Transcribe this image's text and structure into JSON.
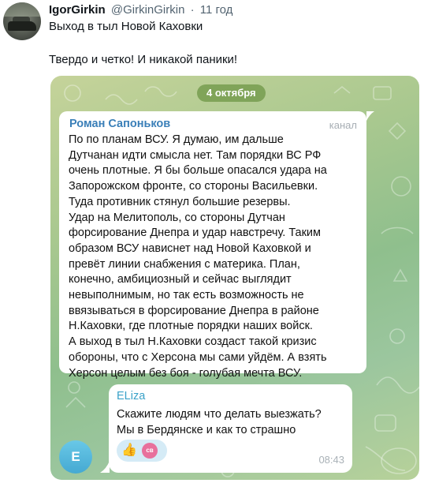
{
  "tweet": {
    "display_name": "IgorGirkin",
    "handle": "@GirkinGirkin",
    "separator": "·",
    "time_ago": "11 год",
    "line1": "Выход в тыл Новой Каховки",
    "line2": "Твердо и четко! И никакой паники!"
  },
  "screenshot": {
    "date_pill": "4 октября",
    "message1": {
      "sender": "Роман Сапоньков",
      "tag": "канал",
      "lines": [
        "По по планам ВСУ. Я думаю, им дальше",
        "Дутчанан идти смысла нет. Там порядки ВС РФ",
        "очень плотные. Я бы больше опасался удара на",
        "Запорожском фронте, со стороны Васильевки.",
        "Туда противник стянул большие резервы.",
        "Удар на Мелитополь, со стороны Дутчан",
        "форсирование Днепра и удар навстречу. Таким",
        "образом ВСУ нависнет над Новой Каховкой и",
        "превёт линии снабжения с материка. План,",
        "конечно, амбициозный и сейчас выглядит",
        "невыполнимым, но так есть возможность не",
        "ввязываться в форсирование Днепра в районе",
        "Н.Каховки, где плотные порядки наших войск.",
        "А выход в тыл Н.Каховки создаст такой кризис",
        "обороны, что с Херсона мы сами уйдём. А взять",
        "Херсон целым без боя - голубая мечта ВСУ."
      ]
    },
    "message2": {
      "sender": "ELiza",
      "lines": [
        "Скажите людям что делать выезжать?",
        "Мы в Бердянске и как то страшно"
      ],
      "reaction_emoji": "👍",
      "reaction_avatar_text": "св",
      "time": "08:43"
    },
    "avatar_letter": "E"
  },
  "colors": {
    "link_blue": "#3a7fb8",
    "eliza_blue": "#3aa2c8",
    "avatar_blue": "#45a9d2",
    "pill_green": "#6e9646"
  }
}
